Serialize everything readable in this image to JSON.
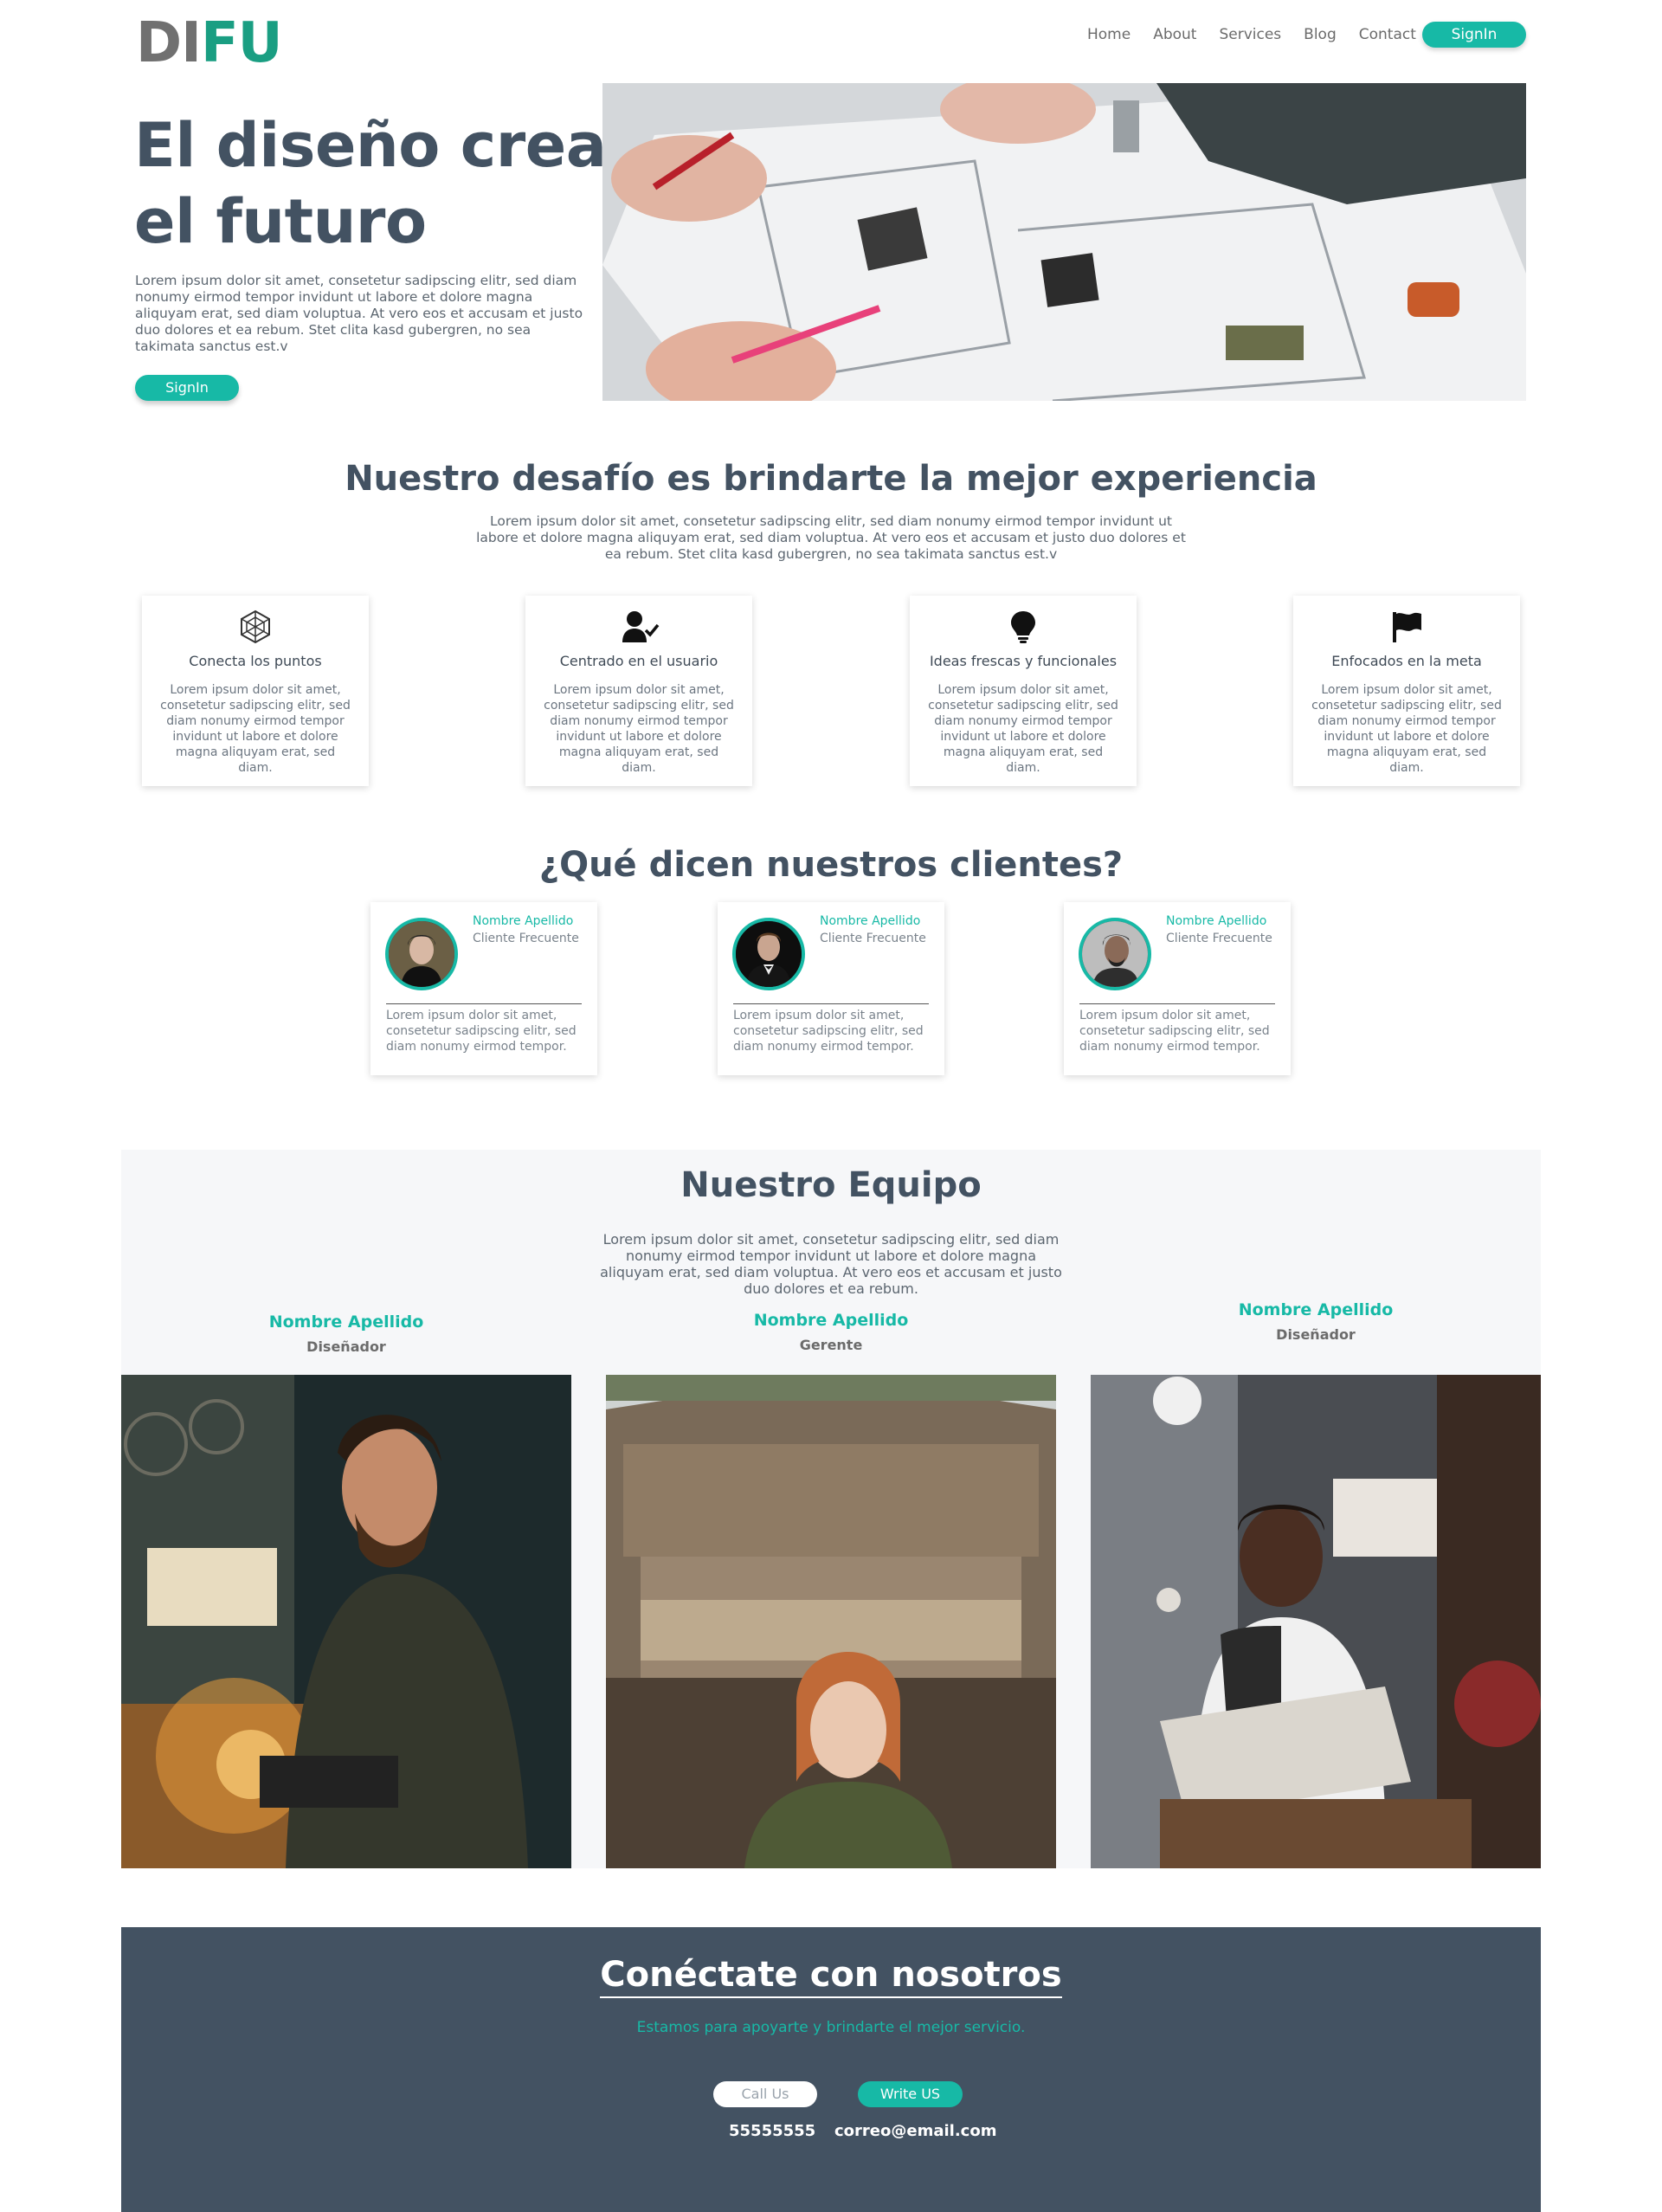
{
  "header": {
    "logo_left": "DI",
    "logo_right": "FU",
    "nav": [
      "Home",
      "About",
      "Services",
      "Blog",
      "Contact"
    ],
    "signin_label": "SignIn"
  },
  "hero": {
    "title": "El diseño crea el futuro",
    "text": "Lorem ipsum dolor sit amet, consetetur sadipscing elitr, sed diam nonumy eirmod tempor invidunt ut labore et dolore magna aliquyam erat, sed diam voluptua. At vero eos et accusam et justo duo dolores et ea rebum. Stet clita kasd gubergren, no sea takimata sanctus est.v",
    "button_label": "SignIn"
  },
  "challenge": {
    "title": "Nuestro desafío es brindarte la mejor experiencia",
    "text": "Lorem ipsum dolor sit amet, consetetur sadipscing elitr, sed diam nonumy eirmod tempor invidunt ut labore et dolore magna aliquyam erat, sed diam voluptua. At vero eos et accusam et justo duo dolores et ea rebum. Stet clita kasd gubergren, no sea takimata sanctus est.v",
    "features": [
      {
        "icon": "hexagon-network-icon",
        "title": "Conecta los puntos",
        "text": "Lorem ipsum dolor sit amet, consetetur sadipscing elitr, sed diam nonumy eirmod tempor invidunt ut labore et dolore magna aliquyam erat, sed diam."
      },
      {
        "icon": "user-check-icon",
        "title": "Centrado en el usuario",
        "text": "Lorem ipsum dolor sit amet, consetetur sadipscing elitr, sed diam nonumy eirmod tempor invidunt ut labore et dolore magna aliquyam erat, sed diam."
      },
      {
        "icon": "lightbulb-icon",
        "title": "Ideas frescas y funcionales",
        "text": "Lorem ipsum dolor sit amet, consetetur sadipscing elitr, sed diam nonumy eirmod tempor invidunt ut labore et dolore magna aliquyam erat, sed diam."
      },
      {
        "icon": "flag-icon",
        "title": "Enfocados en la meta",
        "text": "Lorem ipsum dolor sit amet, consetetur sadipscing elitr, sed diam nonumy eirmod tempor invidunt ut labore et dolore magna aliquyam erat, sed diam."
      }
    ]
  },
  "clients": {
    "title": "¿Qué dicen nuestros clientes?",
    "testimonials": [
      {
        "name": "Nombre Apellido",
        "role": "Cliente Frecuente",
        "text": "Lorem ipsum dolor sit amet, consetetur sadipscing elitr, sed diam nonumy eirmod tempor."
      },
      {
        "name": "Nombre Apellido",
        "role": "Cliente Frecuente",
        "text": "Lorem ipsum dolor sit amet, consetetur sadipscing elitr, sed diam nonumy eirmod tempor."
      },
      {
        "name": "Nombre Apellido",
        "role": "Cliente Frecuente",
        "text": "Lorem ipsum dolor sit amet, consetetur sadipscing elitr, sed diam nonumy eirmod tempor."
      }
    ]
  },
  "team": {
    "title": "Nuestro Equipo",
    "text": "Lorem ipsum dolor sit amet, consetetur sadipscing elitr, sed diam nonumy eirmod tempor invidunt ut labore et dolore magna aliquyam erat, sed diam voluptua. At vero eos et accusam et justo duo dolores et ea rebum.",
    "members": [
      {
        "name": "Nombre Apellido",
        "role": "Diseñador"
      },
      {
        "name": "Nombre Apellido",
        "role": "Gerente"
      },
      {
        "name": "Nombre Apellido",
        "role": "Diseñador"
      }
    ]
  },
  "connect": {
    "title": "Conéctate con nosotros",
    "subtitle": "Estamos para apoyarte y brindarte el mejor servicio.",
    "call_label": "Call Us",
    "write_label": "Write US",
    "phone": "55555555",
    "email": "correo@email.com"
  },
  "colors": {
    "accent": "#17b9a6",
    "logo_green": "#1a9e82",
    "heading": "#435262",
    "footer_bg": "#435262"
  }
}
